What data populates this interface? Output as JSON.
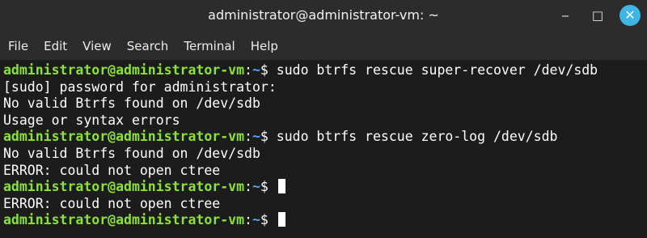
{
  "window": {
    "title": "administrator@administrator-vm: ~",
    "controls": {
      "minimize_icon": "minimize-icon",
      "maximize_icon": "maximize-icon",
      "close_icon": "close-icon",
      "minimize_glyph": "‒",
      "maximize_glyph": "□",
      "close_glyph": "✕"
    }
  },
  "menu": {
    "file": "File",
    "edit": "Edit",
    "view": "View",
    "search": "Search",
    "terminal": "Terminal",
    "help": "Help"
  },
  "terminal": {
    "prompt_user": "administrator@administrator-vm",
    "prompt_sep": ":",
    "prompt_path": "~",
    "prompt_symbol": "$",
    "lines": [
      {
        "type": "prompt",
        "cmd": " sudo btrfs rescue super-recover /dev/sdb"
      },
      {
        "type": "output",
        "text": "[sudo] password for administrator:"
      },
      {
        "type": "output",
        "text": "No valid Btrfs found on /dev/sdb"
      },
      {
        "type": "output",
        "text": "Usage or syntax errors"
      },
      {
        "type": "prompt",
        "cmd": " sudo btrfs rescue zero-log /dev/sdb"
      },
      {
        "type": "output",
        "text": "No valid Btrfs found on /dev/sdb"
      },
      {
        "type": "output",
        "text": "ERROR: could not open ctree"
      },
      {
        "type": "prompt",
        "cmd": " "
      },
      {
        "type": "output",
        "text": "ERROR: could not open ctree"
      },
      {
        "type": "prompt",
        "cmd": " "
      }
    ]
  },
  "colors": {
    "prompt_green": "#8ae234",
    "path_blue": "#5aa0ff",
    "terminal_bg": "#1c1c1c",
    "close_button": "#3eb6e6"
  }
}
